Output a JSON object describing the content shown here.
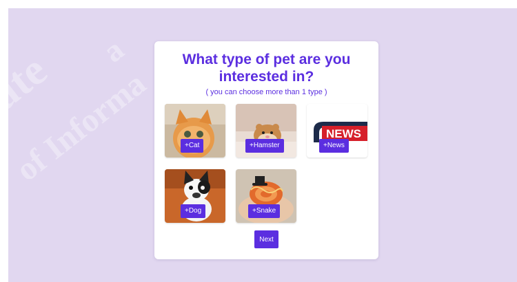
{
  "page": {
    "background_color": "#e1d7f0",
    "accent_color": "#5b2ee0"
  },
  "card": {
    "title": "What type of pet are you interested in?",
    "subtitle": "( you can choose more than 1 type )"
  },
  "options": [
    {
      "label": "+Cat",
      "icon": "cat-photo"
    },
    {
      "label": "+Hamster",
      "icon": "hamster-photo"
    },
    {
      "label": "+News",
      "icon": "news-photo",
      "image_text": "NEWS"
    },
    {
      "label": "+Dog",
      "icon": "dog-photo"
    },
    {
      "label": "+Snake",
      "icon": "snake-photo"
    }
  ],
  "actions": {
    "next_label": "Next"
  }
}
